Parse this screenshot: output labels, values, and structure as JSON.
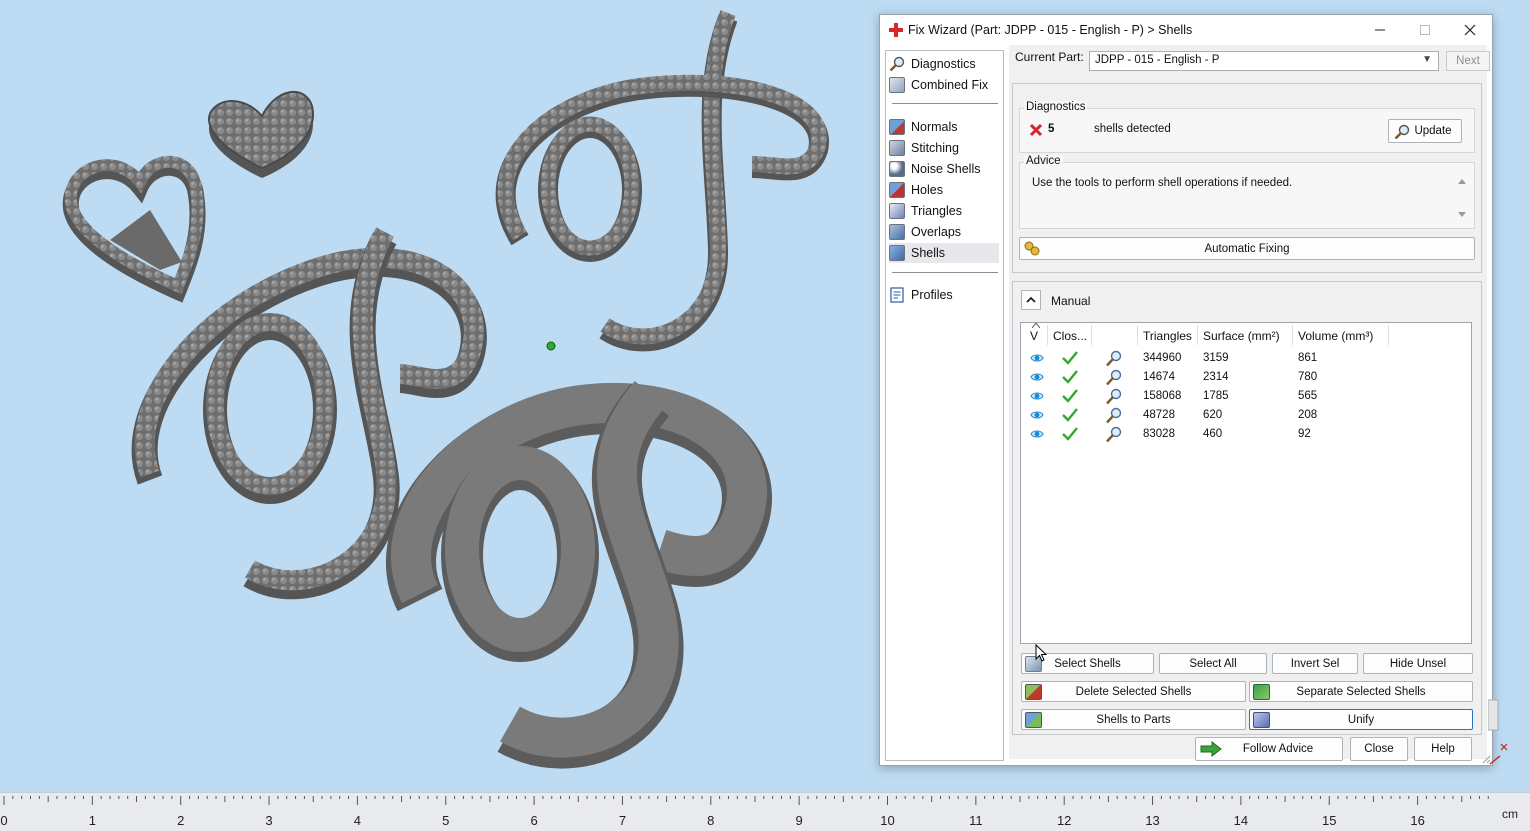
{
  "window": {
    "title": "Fix Wizard (Part: JDPP - 015 - English - P) > Shells",
    "controls": [
      "minimize",
      "maximize",
      "close"
    ]
  },
  "nav": {
    "items": [
      {
        "label": "Diagnostics",
        "icon": "magnifier-icon"
      },
      {
        "label": "Combined Fix",
        "icon": "combined-fix-icon"
      },
      {
        "label": "Normals",
        "icon": "normals-icon"
      },
      {
        "label": "Stitching",
        "icon": "stitching-icon"
      },
      {
        "label": "Noise Shells",
        "icon": "noise-shells-icon"
      },
      {
        "label": "Holes",
        "icon": "holes-icon"
      },
      {
        "label": "Triangles",
        "icon": "triangles-icon"
      },
      {
        "label": "Overlaps",
        "icon": "overlaps-icon"
      },
      {
        "label": "Shells",
        "icon": "shells-icon"
      },
      {
        "label": "Profiles",
        "icon": "profiles-icon"
      }
    ],
    "active": "Shells"
  },
  "current_part": {
    "label": "Current Part:",
    "value": "JDPP - 015 - English - P",
    "next_label": "Next"
  },
  "diagnostics": {
    "title": "Diagnostics",
    "count": "5",
    "text": "shells detected",
    "update_label": "Update"
  },
  "advice": {
    "title": "Advice",
    "text": "Use the tools to perform shell operations if needed."
  },
  "automatic_fixing_label": "Automatic Fixing",
  "manual": {
    "title": "Manual",
    "columns": [
      "V",
      "Clos...",
      "Triangles",
      "Surface (mm²)",
      "Volume (mm³)"
    ],
    "rows": [
      {
        "triangles": "344960",
        "surface": "3159",
        "volume": "861"
      },
      {
        "triangles": "14674",
        "surface": "2314",
        "volume": "780"
      },
      {
        "triangles": "158068",
        "surface": "1785",
        "volume": "565"
      },
      {
        "triangles": "48728",
        "surface": "620",
        "volume": "208"
      },
      {
        "triangles": "83028",
        "surface": "460",
        "volume": "92"
      }
    ],
    "buttons": {
      "select_shells": "Select Shells",
      "select_all": "Select All",
      "invert_sel": "Invert Sel",
      "hide_unsel": "Hide Unsel",
      "delete_selected": "Delete Selected Shells",
      "separate_selected": "Separate Selected Shells",
      "shells_to_parts": "Shells to Parts",
      "unify": "Unify"
    }
  },
  "footer": {
    "follow_advice": "Follow Advice",
    "close": "Close",
    "help": "Help"
  },
  "ruler": {
    "ticks": [
      "0",
      "1",
      "2",
      "3",
      "4",
      "5",
      "6",
      "7",
      "8",
      "9",
      "10",
      "11",
      "12",
      "13",
      "14",
      "15",
      "16"
    ],
    "unit": "cm"
  },
  "colors": {
    "viewport_bg": "#bddcf4",
    "model_gray": "#6f6f6f",
    "accent_red": "#d4262c",
    "check_green": "#2fa92f",
    "eye_blue": "#1a8ad4"
  }
}
